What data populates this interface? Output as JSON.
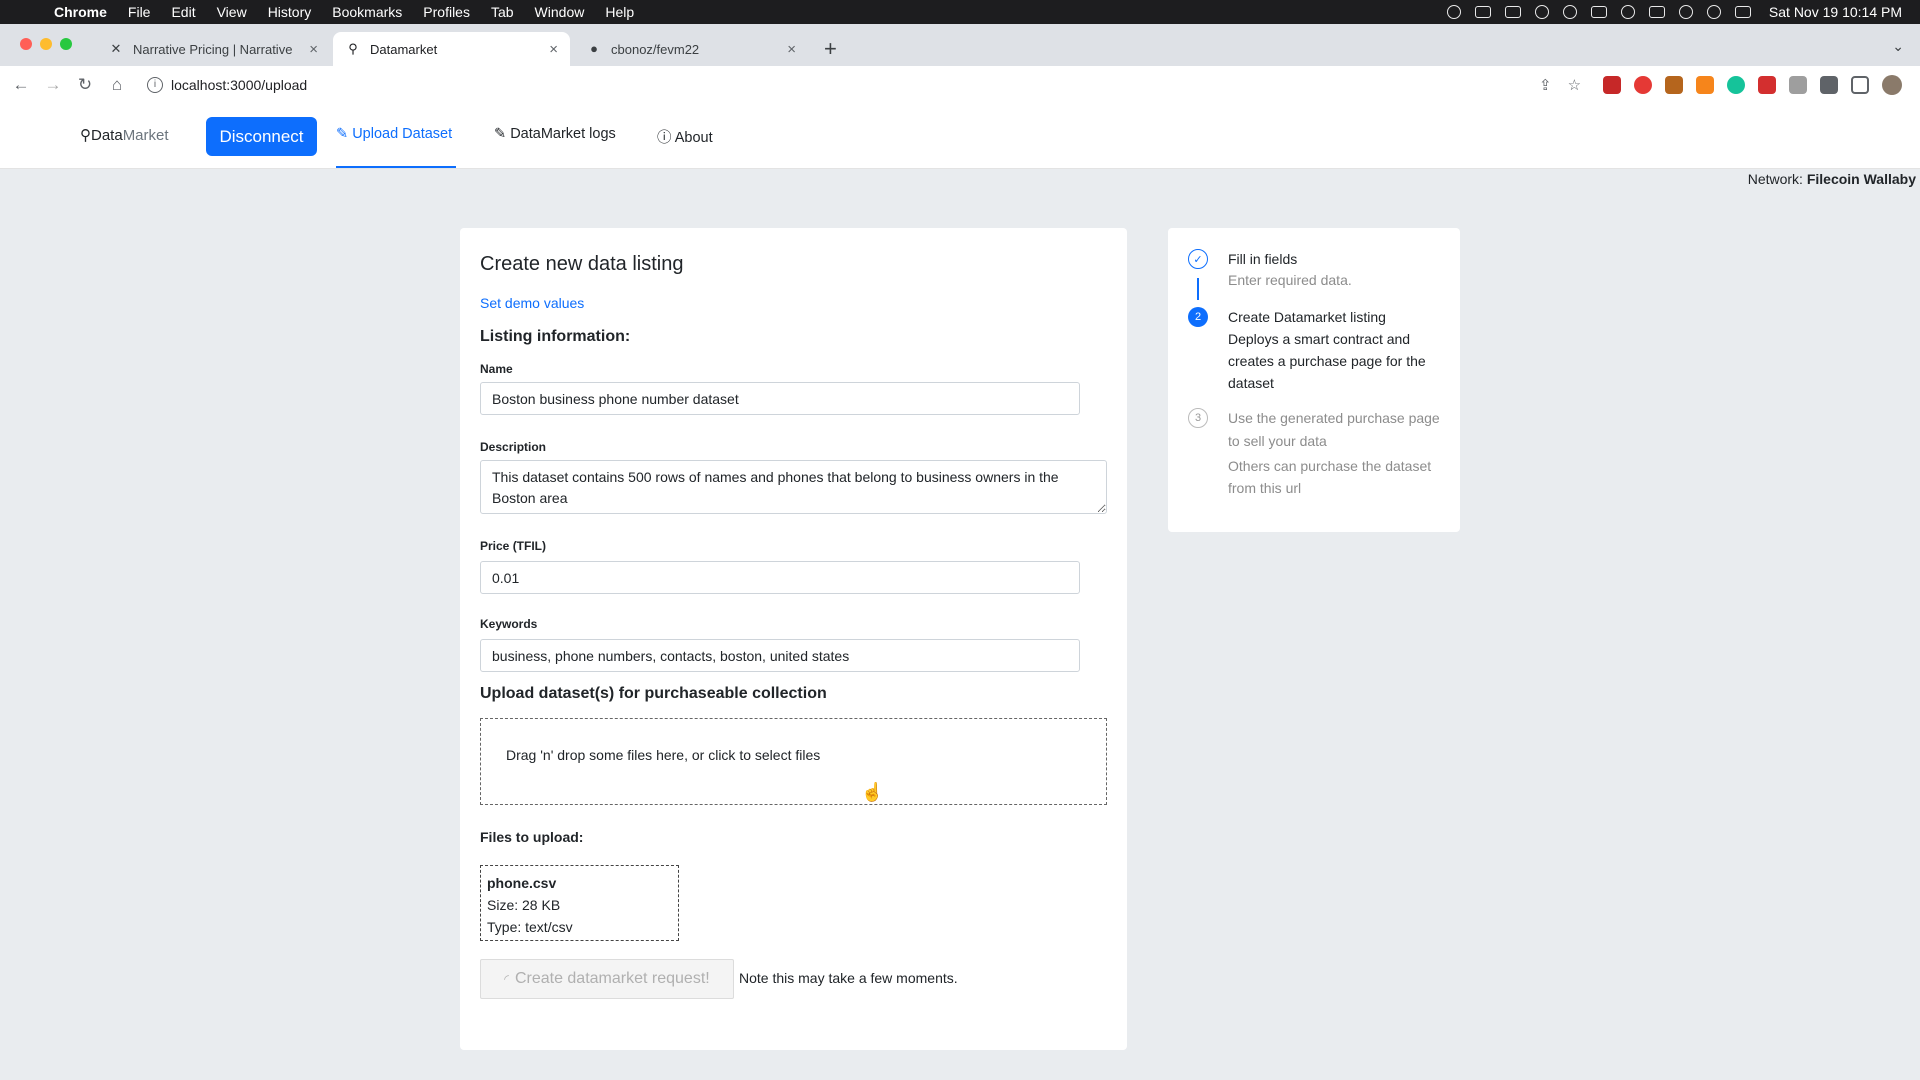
{
  "menubar": {
    "app": "Chrome",
    "items": [
      "File",
      "Edit",
      "View",
      "History",
      "Bookmarks",
      "Profiles",
      "Tab",
      "Window",
      "Help"
    ],
    "clock": "Sat Nov 19  10:14 PM"
  },
  "browser": {
    "tabs": [
      {
        "label": "Narrative Pricing | Narrative",
        "icon": "narrative-icon"
      },
      {
        "label": "Datamarket",
        "icon": "datamarket-icon"
      },
      {
        "label": "cbonoz/fevm22",
        "icon": "github-icon"
      }
    ],
    "url": "localhost:3000/upload"
  },
  "nav": {
    "brand_a": "Data",
    "brand_b": "Market",
    "disconnect": "Disconnect",
    "upload": "Upload Dataset",
    "logs": "DataMarket logs",
    "about": "About",
    "network_label": "Network:",
    "network_value": "Filecoin Wallaby"
  },
  "form": {
    "title": "Create new data listing",
    "demo_link": "Set demo values",
    "section_listing": "Listing information:",
    "name_label": "Name",
    "name_value": "Boston business phone number dataset",
    "description_label": "Description",
    "description_value": "This dataset contains 500 rows of names and phones that belong to business owners in the Boston area",
    "price_label": "Price (TFIL)",
    "price_value": "0.01",
    "keywords_label": "Keywords",
    "keywords_value": "business, phone numbers, contacts, boston, united states",
    "upload_heading": "Upload dataset(s) for purchaseable collection",
    "dropzone_text": "Drag 'n' drop some files here, or click to select files",
    "files_heading": "Files to upload:",
    "file": {
      "name": "phone.csv",
      "size": "Size: 28 KB",
      "type": "Type: text/csv"
    },
    "submit": "Create datamarket request!",
    "note": "Note this may take a few moments."
  },
  "steps": [
    {
      "num": "✓",
      "title": "Fill in fields",
      "desc": "Enter required data.",
      "state": "done"
    },
    {
      "num": "2",
      "title": "Create Datamarket listing",
      "desc": "Deploys a smart contract and creates a purchase page for the dataset",
      "state": "current"
    },
    {
      "num": "3",
      "title": "Use the generated purchase page to sell your data",
      "desc": "Others can purchase the dataset from this url",
      "state": "todo"
    }
  ],
  "colors": {
    "primary": "#0d6efd",
    "page_bg": "#e9ecef"
  }
}
